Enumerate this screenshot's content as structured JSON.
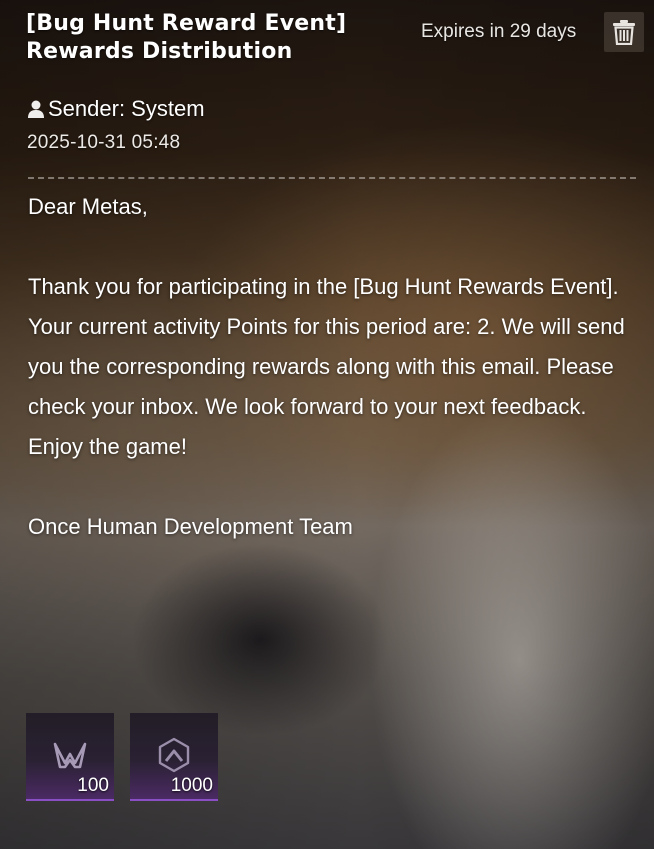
{
  "mail": {
    "title_line1": "[Bug Hunt Reward Event]",
    "title_line2": "Rewards Distribution",
    "expires": "Expires in 29 days",
    "sender": "Sender: System",
    "date": "2025-10-31 05:48",
    "greeting": "Dear Metas,",
    "message": "Thank you for participating in the [Bug Hunt Rewards Event]. Your current activity Points for this period are: 2. We will send you the corresponding rewards along with this email. Please check your inbox. We look forward to your next feedback. Enjoy the game!",
    "signature": "Once Human Development Team"
  },
  "rewards": [
    {
      "icon": "m-emblem-icon",
      "quantity": "100"
    },
    {
      "icon": "hexagon-chevron-icon",
      "quantity": "1000"
    }
  ],
  "colors": {
    "accent_purple": "#8a4fc4",
    "text": "#ffffff"
  }
}
